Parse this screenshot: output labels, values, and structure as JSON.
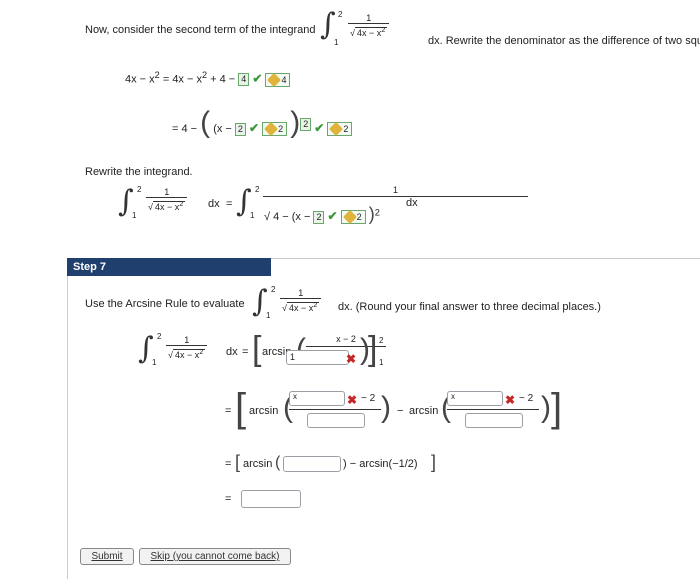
{
  "intro": {
    "lead": "Now, consider the second term of the integrand",
    "tail": "dx. Rewrite the denominator as the difference of two square"
  },
  "integral": {
    "lower": "1",
    "upper": "2",
    "numerator": "1",
    "radicand": "4x − x",
    "exp": "2",
    "dx": "dx"
  },
  "line1": {
    "lhs": "4x − x",
    "exp": "2",
    "eq": "=",
    "rhs": "4x − x",
    "rhs_tail": "+ 4 −",
    "box_value": "4",
    "answer_value": "4"
  },
  "line2": {
    "prefix": "= 4 −",
    "inner": "(x −",
    "box_value": "2",
    "answer_value": "2",
    "exp_box": "2",
    "exp_answer": "2"
  },
  "rewrite_label": "Rewrite the integrand.",
  "rewrite": {
    "eq": "=",
    "rad_prefix": "4 − (x −",
    "box_value": "2",
    "answer_value": "2",
    "exp": "2",
    "dx": "dx"
  },
  "step": {
    "label": "Step 7"
  },
  "arcsine": {
    "lead": "Use the Arcsine Rule to evaluate",
    "tail": "dx. (Round your final answer to three decimal places.)"
  },
  "eval1": {
    "eq": "=",
    "func": "arcsin",
    "frac_num": "x − 2",
    "input_value": "1",
    "upper": "2",
    "lower": "1"
  },
  "eval2": {
    "eq": "=",
    "func1": "arcsin",
    "x1": "x",
    "minus2": "− 2",
    "minus": "−",
    "func2": "arcsin",
    "x2": "x",
    "minus2b": "− 2"
  },
  "eval3": {
    "eq": "=",
    "func": "arcsin",
    "tail": ") − arcsin(−1/2)"
  },
  "eval4": {
    "eq": "="
  },
  "buttons": {
    "submit": "Submit",
    "skip": "Skip (you cannot come back)"
  },
  "colors": {
    "step_bar": "#1f3f6f",
    "check": "#3a9a3a",
    "cross": "#c62828"
  }
}
